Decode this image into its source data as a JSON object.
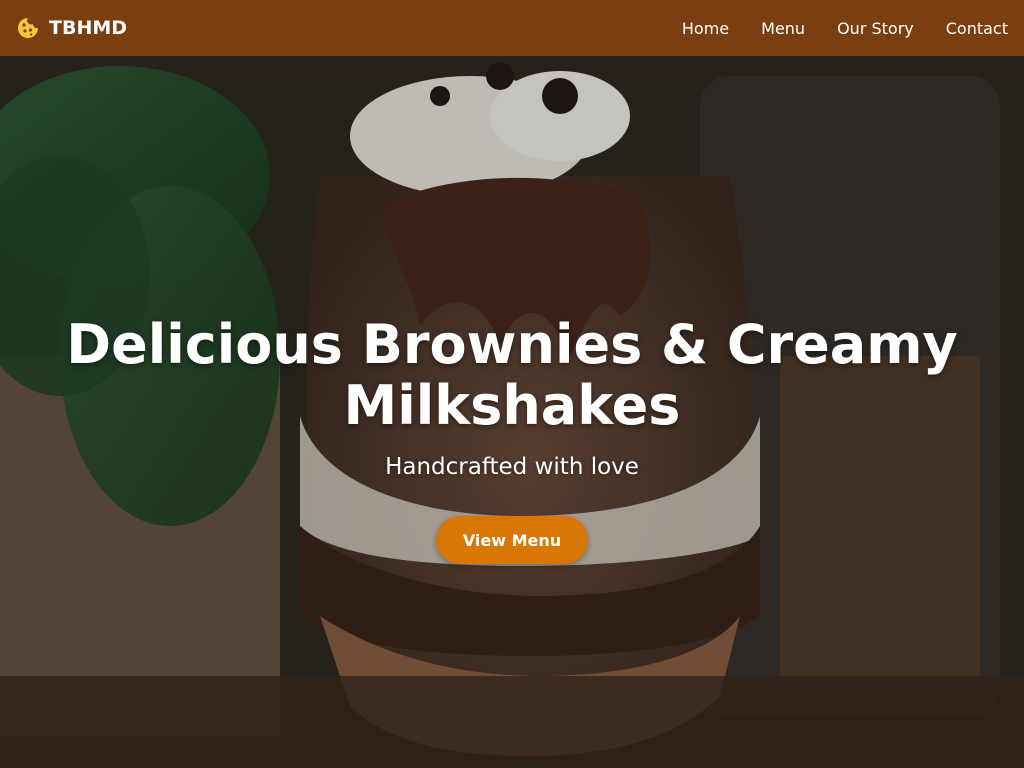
{
  "brand": {
    "name": "TBHMD",
    "icon": "cookie-icon"
  },
  "nav": {
    "links": [
      {
        "label": "Home"
      },
      {
        "label": "Menu"
      },
      {
        "label": "Our Story"
      },
      {
        "label": "Contact"
      }
    ]
  },
  "hero": {
    "title": "Delicious Brownies & Creamy Milkshakes",
    "subtitle": "Handcrafted with love",
    "cta_label": "View Menu"
  },
  "colors": {
    "navbar": "#7a3e10",
    "accent": "#d97706",
    "cookie": "#f5c542",
    "text": "#ffffff"
  }
}
